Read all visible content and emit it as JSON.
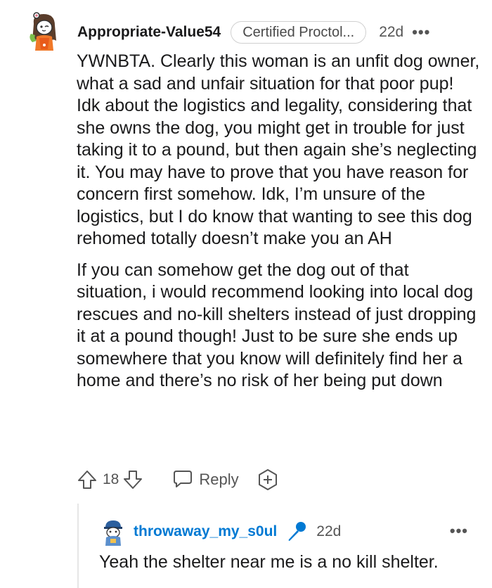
{
  "comment": {
    "username": "Appropriate-Value54",
    "flair": "Certified Proctol...",
    "time": "22d",
    "more_label": "•••",
    "paragraphs": [
      "YWNBTA. Clearly this woman is an unfit dog owner, what a sad and unfair situation for that poor pup! Idk about the logistics and legality, considering that she owns the dog, you might get in trouble for just taking it to a pound, but then again she’s neglecting it. You may have to prove that you have reason for concern first somehow. Idk, I’m unsure of the logistics, but I do know that wanting to see this dog rehomed totally doesn’t make you an AH",
      "If you can somehow get the dog out of that situation, i would recommend looking into local dog rescues and no-kill shelters instead of just dropping it at a pound though! Just to be sure she ends up somewhere that you know will definitely find her a home and there’s no risk of her being put down"
    ],
    "score": "18",
    "reply_label": "Reply",
    "icons": {
      "upvote": "upvote-arrow-icon",
      "downvote": "downvote-arrow-icon",
      "reply": "speech-bubble-icon",
      "award": "award-plus-icon"
    }
  },
  "reply": {
    "username": "throwaway_my_s0ul",
    "time": "22d",
    "more_label": "•••",
    "text": "Yeah the shelter near me is a no kill shelter.",
    "icons": {
      "badge": "microphone-icon"
    }
  },
  "colors": {
    "username_link": "#0079d3",
    "mic": "#0079d3",
    "meta_text": "#555555",
    "thread_line": "#e6e6e6"
  }
}
